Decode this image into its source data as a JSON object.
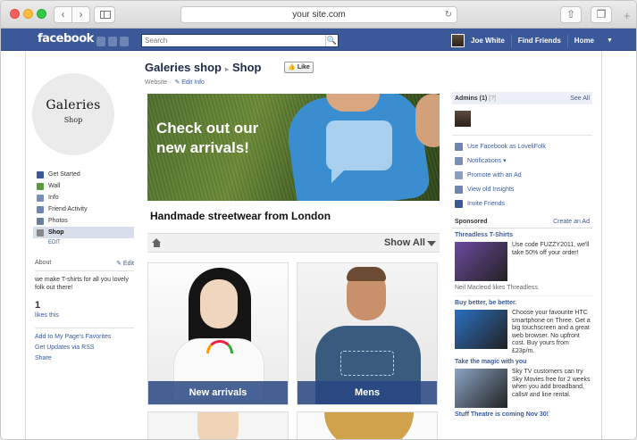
{
  "browser": {
    "url": "your site.com",
    "back_label": "‹",
    "forward_label": "›",
    "reload_label": "↻",
    "share_label": "⇧",
    "tabs_label": "❐",
    "newtab_label": "+"
  },
  "fbheader": {
    "logo": "facebook",
    "search_placeholder": "Search",
    "search_icon": "🔍",
    "user_name": "Joe White",
    "find_friends": "Find Friends",
    "home": "Home",
    "menu_caret": "▼"
  },
  "left": {
    "profile_line1": "Galeries",
    "profile_line2": "Shop",
    "nav": [
      {
        "label": "Get Started",
        "icon": "get-started-icon",
        "color": "#3b5998"
      },
      {
        "label": "Wall",
        "icon": "wall-icon",
        "color": "#5a9a3c"
      },
      {
        "label": "Info",
        "icon": "info-icon",
        "color": "#7a8fb8"
      },
      {
        "label": "Friend Activity",
        "icon": "friend-activity-icon",
        "color": "#6d84b4"
      },
      {
        "label": "Photos",
        "icon": "photos-icon",
        "color": "#6a7f9e"
      },
      {
        "label": "Shop",
        "icon": "shop-cart-icon",
        "color": "#888888"
      }
    ],
    "nav_edit": "EDIT",
    "about_title": "About",
    "about_edit": "✎ Edit",
    "about_text": "we make T-shirts for all you lovely folk out there!",
    "likes_count": "1",
    "likes_label": "likes this",
    "links": [
      "Add to My Page's Favorites",
      "Get Updates via RSS",
      "Share"
    ]
  },
  "main": {
    "page_name": "Galeries shop",
    "separator": "▸",
    "section": "Shop",
    "like_button": "👍 Like",
    "category": "Website ·",
    "edit_info": "✎ Edit Info",
    "banner_line1": "Check out our",
    "banner_line2": "new arrivals!",
    "headline": "Handmade streetwear from London",
    "show_all": "Show All",
    "tiles": [
      {
        "label": "New arrivals"
      },
      {
        "label": "Mens"
      }
    ]
  },
  "right": {
    "admins_title": "Admins (1)",
    "admins_help": "[?]",
    "see_all": "See All",
    "actions": [
      {
        "label": "Use Facebook as LoveliFolk",
        "icon": "swap-icon",
        "color": "#6d84b4"
      },
      {
        "label": "Notifications ▾",
        "icon": "notifications-icon",
        "color": "#7a8fb8"
      },
      {
        "label": "Promote with an Ad",
        "icon": "promote-icon",
        "color": "#8b9dc3"
      },
      {
        "label": "View old Insights",
        "icon": "insights-icon",
        "color": "#6d84b4"
      },
      {
        "label": "Invite Friends",
        "icon": "invite-icon",
        "color": "#3b5998"
      }
    ],
    "sponsored": "Sponsored",
    "create_ad": "Create an Ad",
    "ads": [
      {
        "title": "Threadless T-Shirts",
        "text": "Use code FUZZY2011, we'll take 50% off your order!",
        "foot": "Neil Macleod likes Threadless.",
        "img_color": "#6d4aa0"
      },
      {
        "title": "Buy better, be better.",
        "text": "Choose your favourite HTC smartphone on Three. Get a big touchscreen and a great web browser. No upfront cost. Buy yours from £23p/m.",
        "foot": "",
        "img_color": "#2b6fc0"
      },
      {
        "title": "Take the magic with you",
        "text": "Sky TV customers can try Sky Movies free for 2 weeks when you add broadband, calls# and line rental.",
        "foot": "",
        "img_color": "#8aa4c4"
      },
      {
        "title": "Stuff Theatre is coming Nov 30!",
        "text": "",
        "foot": "",
        "img_color": "#cccccc"
      }
    ]
  }
}
